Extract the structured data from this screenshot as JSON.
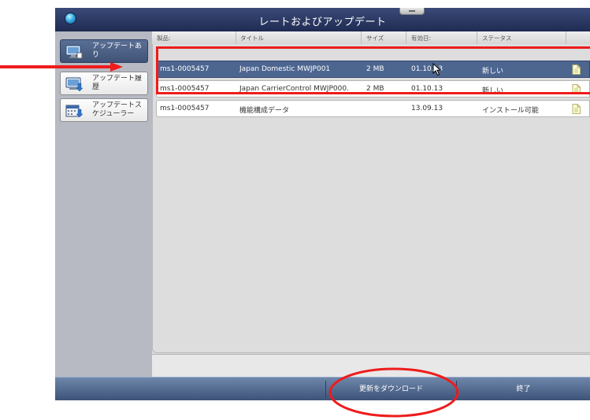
{
  "window": {
    "title": "レートおよびアップデート"
  },
  "sidebar": {
    "items": [
      {
        "label": "アップデートあり",
        "icon": "monitor-icon",
        "active": true
      },
      {
        "label": "アップデート履歴",
        "icon": "monitor-download-icon",
        "active": false
      },
      {
        "label": "アップデートスケジューラー",
        "icon": "calendar-download-icon",
        "active": false
      }
    ]
  },
  "table": {
    "headers": [
      "製品:",
      "タイトル",
      "サイズ",
      "有効日:",
      "ステータス"
    ],
    "rows": [
      {
        "product": "ms1-0005457",
        "title": "Japan Domestic MWJP001",
        "size": "2 MB",
        "date": "01.10.13",
        "status": "新しい"
      },
      {
        "product": "ms1-0005457",
        "title": "Japan CarrierControl MWJP000.",
        "size": "2 MB",
        "date": "01.10.13",
        "status": "新しい"
      },
      {
        "product": "ms1-0005457",
        "title": "機能構成データ",
        "size": "",
        "date": "13.09.13",
        "status": "インストール可能"
      }
    ]
  },
  "footer": {
    "download_label": "更新をダウンロード",
    "exit_label": "終了"
  },
  "colors": {
    "annotation": "#ee1c1c",
    "selected_row": "#4d6690",
    "titlebar": "#1f2b52"
  }
}
